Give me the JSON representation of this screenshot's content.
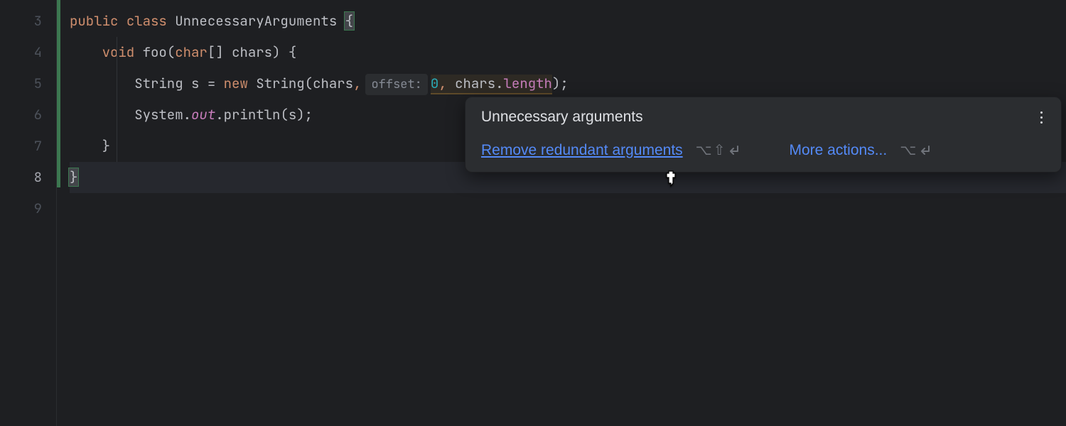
{
  "gutter": {
    "lines": [
      "3",
      "4",
      "5",
      "6",
      "7",
      "8",
      "9"
    ],
    "current": "8"
  },
  "code": {
    "line3": {
      "kw1": "public",
      "kw2": "class",
      "name": "UnnecessaryArguments",
      "brace": "{"
    },
    "line4": {
      "kw": "void",
      "method": "foo",
      "paren_open": "(",
      "type": "char",
      "brackets": "[]",
      "param": "chars",
      "paren_close": ")",
      "brace": "{"
    },
    "line5": {
      "type": "String",
      "var": "s",
      "eq": "=",
      "kw": "new",
      "ctor": "String",
      "paren_open": "(",
      "arg1": "chars",
      "comma1": ",",
      "hint_label": "offset:",
      "arg2": "0",
      "comma2": ",",
      "arg3a": "chars",
      "dot": ".",
      "arg3b": "length",
      "paren_close": ")",
      "semi": ";"
    },
    "line6": {
      "cls": "System",
      "dot1": ".",
      "field": "out",
      "dot2": ".",
      "method": "println",
      "paren_open": "(",
      "arg": "s",
      "paren_close": ")",
      "semi": ";"
    },
    "line7": {
      "brace": "}"
    },
    "line8": {
      "brace": "}"
    }
  },
  "popup": {
    "title": "Unnecessary arguments",
    "action_label": "Remove redundant arguments",
    "more_label": "More actions...",
    "shortcut1": {
      "opt": "⌥",
      "shift": "⇧",
      "enter": "↵"
    },
    "shortcut2": {
      "opt": "⌥",
      "enter": "↵"
    }
  }
}
